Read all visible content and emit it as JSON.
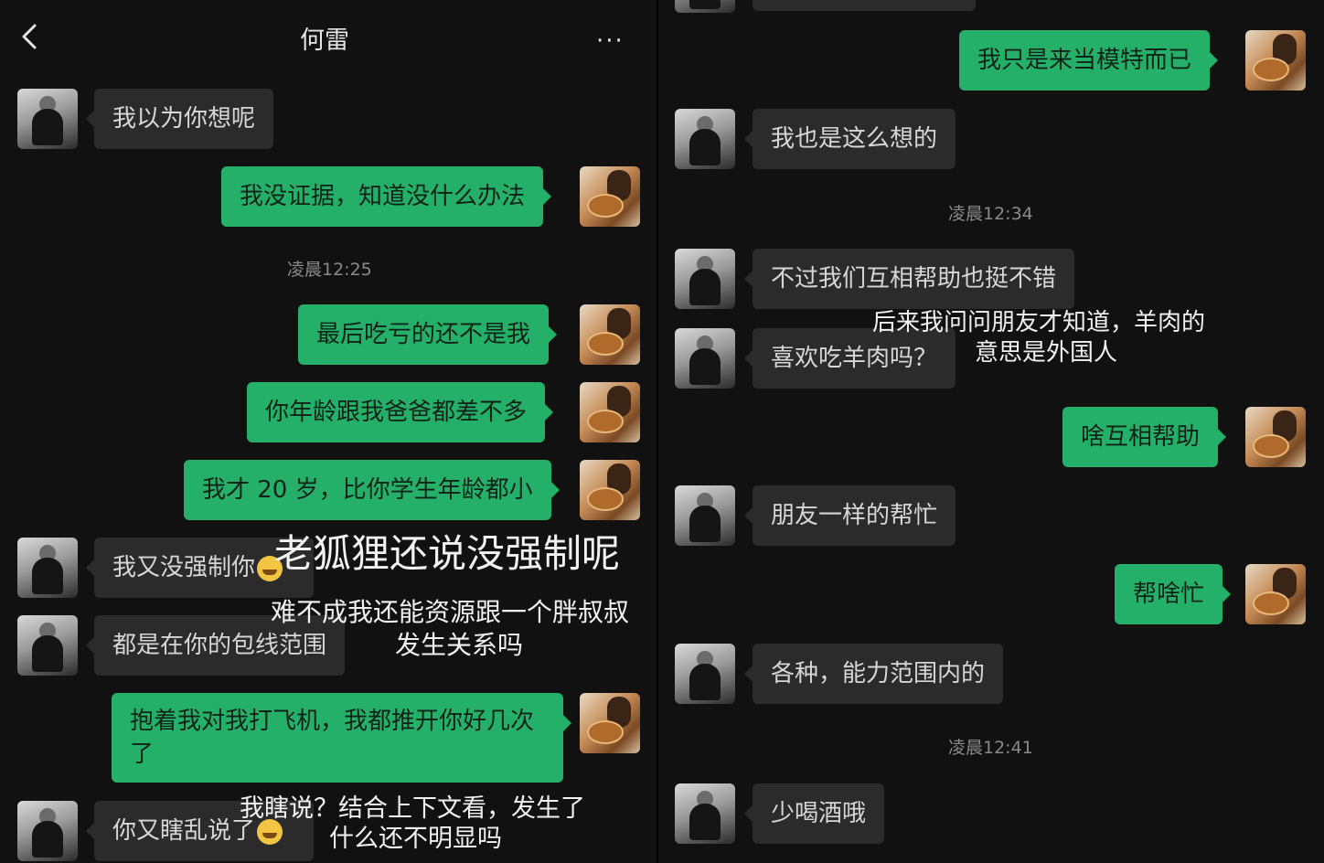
{
  "header": {
    "title": "何雷",
    "more": "···"
  },
  "left": {
    "messages": [
      "我以为你想呢",
      "我没证据，知道没什么办法",
      "最后吃亏的还不是我",
      "你年龄跟我爸爸都差不多",
      "我才 20 岁，比你学生年龄都小",
      "我又没强制你",
      "都是在你的包线范围",
      "抱着我对我打飞机，我都推开你好几次了",
      "你又瞎乱说了"
    ],
    "time": "凌晨12:25",
    "overlays": [
      "老狐狸还说没强制呢",
      "难不成我还能资源跟一个胖叔叔",
      "发生关系吗",
      "我瞎说？结合上下文看，发生了",
      "什么还不明显吗"
    ]
  },
  "right": {
    "messages": [
      "我只是来当模特而已",
      "我也是这么想的",
      "不过我们互相帮助也挺不错",
      "喜欢吃羊肉吗？",
      "啥互相帮助",
      "朋友一样的帮忙",
      "帮啥忙",
      "各种，能力范围内的",
      "少喝酒哦"
    ],
    "times": [
      "凌晨12:34",
      "凌晨12:41"
    ],
    "overlays": [
      "后来我问问朋友才知道，羊肉的",
      "意思是外国人"
    ]
  },
  "colors": {
    "my_bubble": "#25b06a",
    "their_bubble": "#2b2b2b",
    "background": "#111111"
  }
}
